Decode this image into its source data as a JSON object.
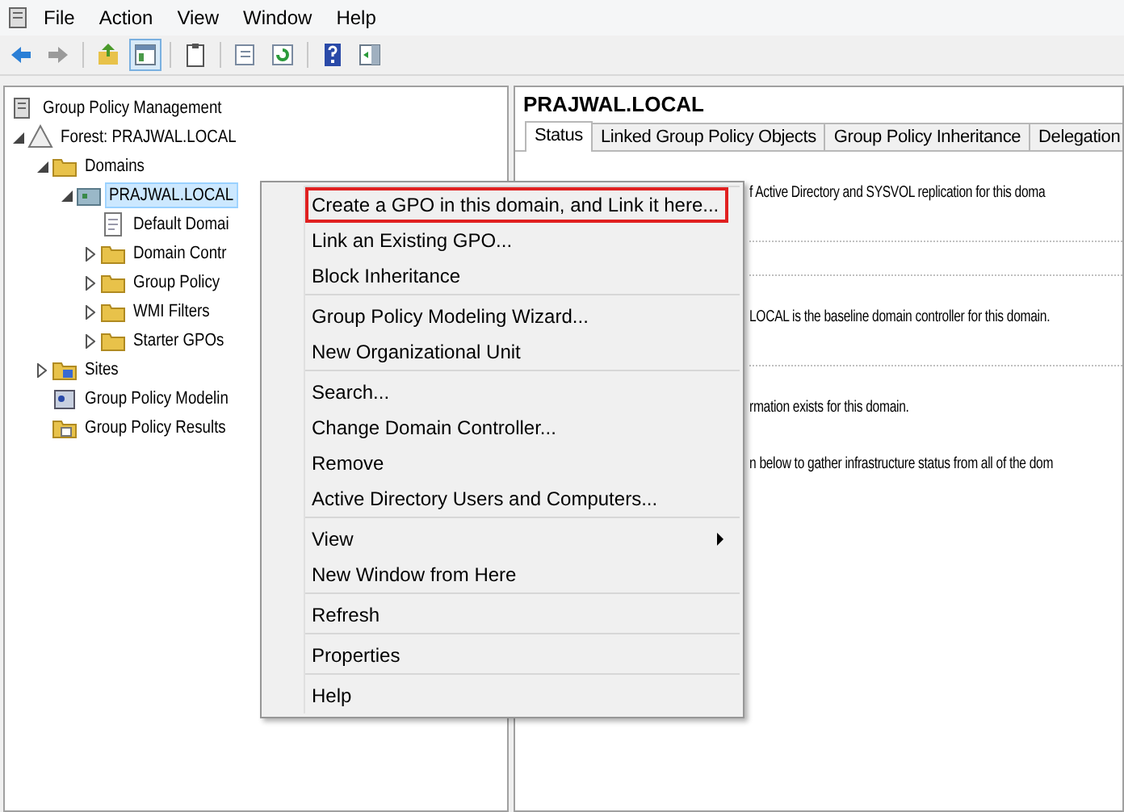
{
  "menu_bar": {
    "items": [
      "File",
      "Action",
      "View",
      "Window",
      "Help"
    ]
  },
  "toolbar": [
    {
      "kind": "back",
      "pressed": false
    },
    {
      "kind": "forward",
      "pressed": false
    },
    {
      "kind": "up-folder",
      "pressed": false
    },
    {
      "kind": "console-tree",
      "pressed": true
    },
    {
      "kind": "clipboard",
      "pressed": false
    },
    {
      "kind": "export",
      "pressed": false
    },
    {
      "kind": "refresh",
      "pressed": false
    },
    {
      "kind": "help",
      "pressed": false
    },
    {
      "kind": "panel",
      "pressed": false
    }
  ],
  "tree": [
    {
      "label": "Group Policy Management",
      "kind": "root",
      "selected": false,
      "children": [
        {
          "label": "Forest: PRAJWAL.LOCAL",
          "kind": "forest",
          "expanded": true,
          "selected": false,
          "children": [
            {
              "label": "Domains",
              "kind": "domains",
              "expanded": true,
              "selected": false,
              "children": [
                {
                  "label": "PRAJWAL.LOCAL",
                  "kind": "domain",
                  "expanded": true,
                  "selected": true,
                  "children": [
                    {
                      "label": "Default Domai",
                      "kind": "gpo",
                      "selected": false
                    },
                    {
                      "label": "Domain Contr",
                      "kind": "folder",
                      "expanded": false,
                      "selected": false
                    },
                    {
                      "label": "Group Policy",
                      "kind": "folder",
                      "expanded": false,
                      "selected": false
                    },
                    {
                      "label": "WMI Filters",
                      "kind": "folder",
                      "expanded": false,
                      "selected": false
                    },
                    {
                      "label": "Starter GPOs",
                      "kind": "folder",
                      "expanded": false,
                      "selected": false
                    }
                  ]
                }
              ]
            },
            {
              "label": "Sites",
              "kind": "sites",
              "expanded": false,
              "selected": false
            },
            {
              "label": "Group Policy Modelin",
              "kind": "modeling",
              "selected": false
            },
            {
              "label": "Group Policy Results",
              "kind": "results",
              "selected": false
            }
          ]
        }
      ]
    }
  ],
  "details": {
    "title": "PRAJWAL.LOCAL",
    "tabs": [
      {
        "label": "Status",
        "selected": true
      },
      {
        "label": "Linked Group Policy Objects",
        "selected": false
      },
      {
        "label": "Group Policy Inheritance",
        "selected": false
      },
      {
        "label": "Delegation",
        "selected": false
      }
    ],
    "content": [
      {
        "kind": "text",
        "text": "f Active Directory and SYSVOL replication for this doma"
      },
      {
        "kind": "rule"
      },
      {
        "kind": "rule"
      },
      {
        "kind": "text",
        "text": "LOCAL is the baseline domain controller for this domain."
      },
      {
        "kind": "rule"
      },
      {
        "kind": "text",
        "text": "rmation exists for this domain."
      },
      {
        "kind": "text",
        "text": "n below to gather infrastructure status from all of the dom"
      }
    ]
  },
  "context_menu": {
    "groups": [
      [
        {
          "label": "Create a GPO in this domain, and Link it here...",
          "highlighted": true,
          "submenu": false
        },
        {
          "label": "Link an Existing GPO...",
          "highlighted": false,
          "submenu": false
        },
        {
          "label": "Block Inheritance",
          "highlighted": false,
          "submenu": false
        }
      ],
      [
        {
          "label": "Group Policy Modeling Wizard...",
          "highlighted": false,
          "submenu": false
        },
        {
          "label": "New Organizational Unit",
          "highlighted": false,
          "submenu": false
        }
      ],
      [
        {
          "label": "Search...",
          "highlighted": false,
          "submenu": false
        },
        {
          "label": "Change Domain Controller...",
          "highlighted": false,
          "submenu": false
        },
        {
          "label": "Remove",
          "highlighted": false,
          "submenu": false
        },
        {
          "label": "Active Directory Users and Computers...",
          "highlighted": false,
          "submenu": false
        }
      ],
      [
        {
          "label": "View",
          "highlighted": false,
          "submenu": true
        },
        {
          "label": "New Window from Here",
          "highlighted": false,
          "submenu": false
        }
      ],
      [
        {
          "label": "Refresh",
          "highlighted": false,
          "submenu": false
        }
      ],
      [
        {
          "label": "Properties",
          "highlighted": false,
          "submenu": false
        }
      ],
      [
        {
          "label": "Help",
          "highlighted": false,
          "submenu": false
        }
      ]
    ]
  }
}
